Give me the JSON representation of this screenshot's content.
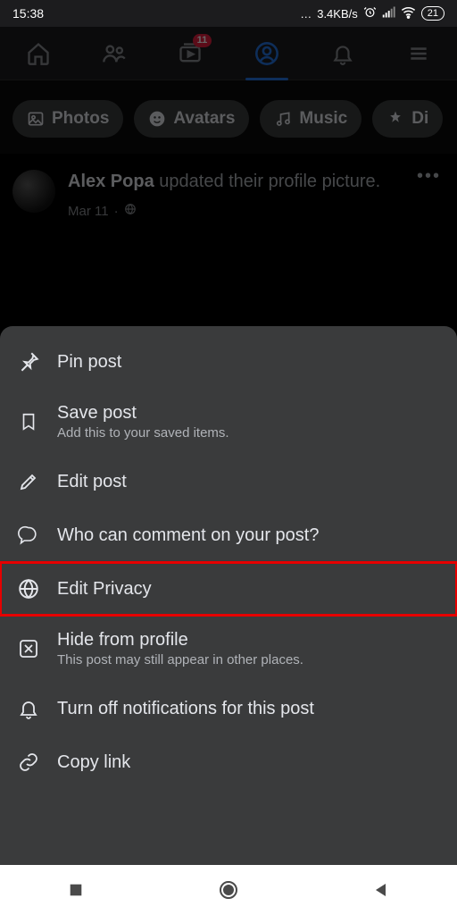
{
  "status": {
    "time": "15:38",
    "net_speed": "3.4KB/s",
    "battery": "21"
  },
  "tabs": {
    "watch_badge": "11"
  },
  "chips": {
    "photos": "Photos",
    "avatars": "Avatars",
    "music": "Music",
    "did": "Di"
  },
  "post": {
    "name": "Alex Popa",
    "action": "updated their profile picture.",
    "date": "Mar 11"
  },
  "sheet": {
    "pin": {
      "title": "Pin post"
    },
    "save": {
      "title": "Save post",
      "sub": "Add this to your saved items."
    },
    "edit": {
      "title": "Edit post"
    },
    "comment": {
      "title": "Who can comment on your post?"
    },
    "privacy": {
      "title": "Edit Privacy"
    },
    "hide": {
      "title": "Hide from profile",
      "sub": "This post may still appear in other places."
    },
    "notif": {
      "title": "Turn off notifications for this post"
    },
    "copy": {
      "title": "Copy link"
    }
  }
}
